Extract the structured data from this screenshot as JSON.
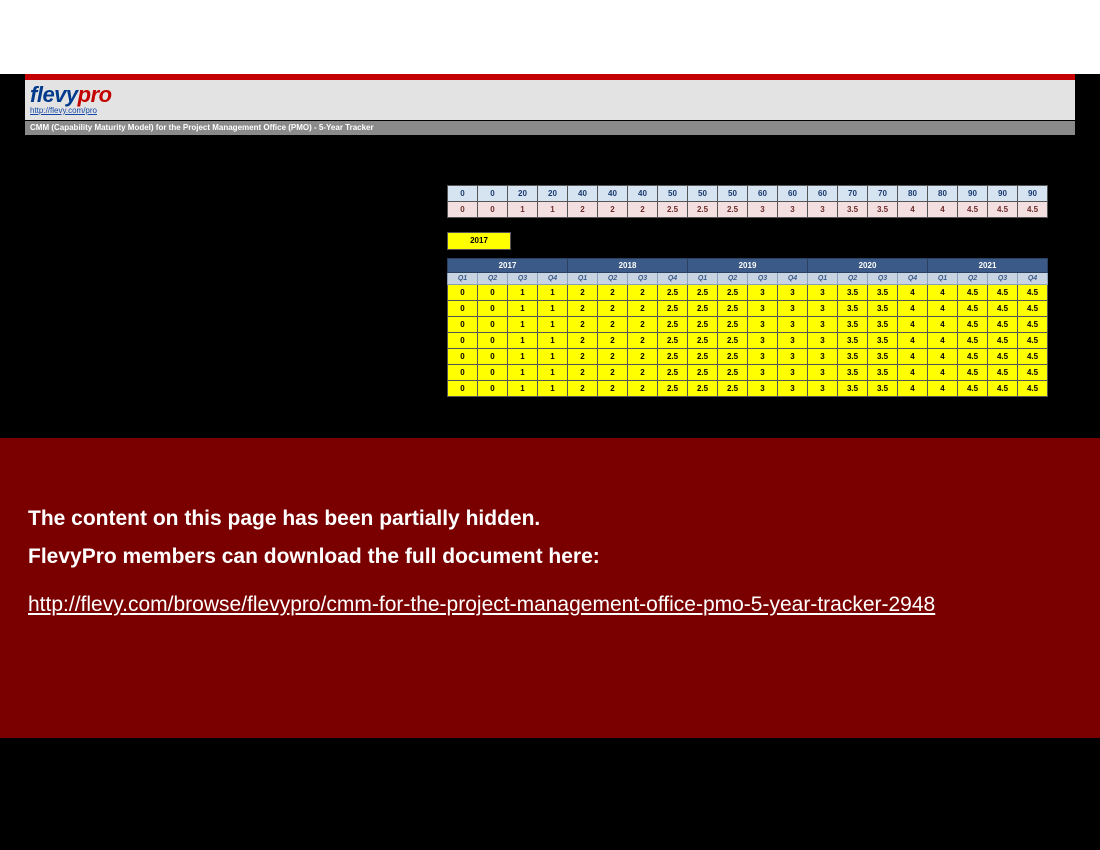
{
  "header": {
    "logo_main": "flevy",
    "logo_sub": "pro",
    "logo_url": "http://flevy.com/pro",
    "title": "CMM (Capability Maturity Model) for the Project Management Office (PMO) - 5-Year Tracker"
  },
  "top_rows": {
    "blue": [
      "0",
      "0",
      "20",
      "20",
      "40",
      "40",
      "40",
      "50",
      "50",
      "50",
      "60",
      "60",
      "60",
      "70",
      "70",
      "80",
      "80",
      "90",
      "90",
      "90"
    ],
    "pink": [
      "0",
      "0",
      "1",
      "1",
      "2",
      "2",
      "2",
      "2.5",
      "2.5",
      "2.5",
      "3",
      "3",
      "3",
      "3.5",
      "3.5",
      "4",
      "4",
      "4.5",
      "4.5",
      "4.5"
    ]
  },
  "year_badge": "2017",
  "years": [
    "2017",
    "2018",
    "2019",
    "2020",
    "2021"
  ],
  "quarters": [
    "Q1",
    "Q2",
    "Q3",
    "Q4"
  ],
  "data_row": [
    "0",
    "0",
    "1",
    "1",
    "2",
    "2",
    "2",
    "2.5",
    "2.5",
    "2.5",
    "3",
    "3",
    "3",
    "3.5",
    "3.5",
    "4",
    "4",
    "4.5",
    "4.5",
    "4.5"
  ],
  "data_row_count": 7,
  "overlay": {
    "line1": "The content on this page has been partially hidden.",
    "line2": "FlevyPro members can download the full document here:",
    "link_text": "http://flevy.com/browse/flevypro/cmm-for-the-project-management-office-pmo-5-year-tracker-2948"
  }
}
